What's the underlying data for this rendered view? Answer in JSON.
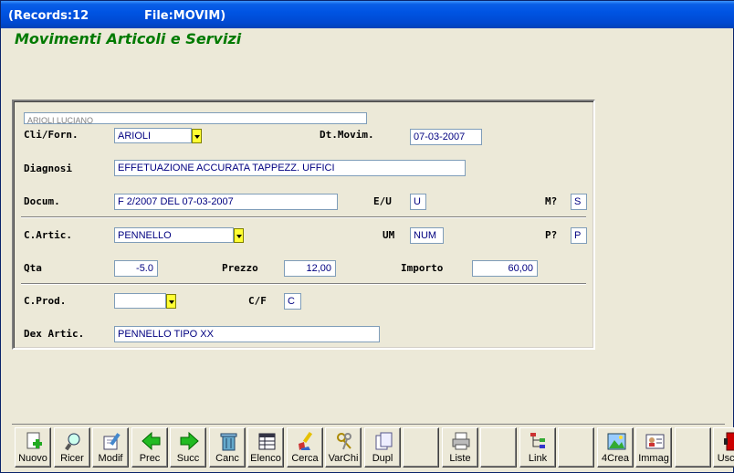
{
  "window": {
    "title_records": "(Records:12",
    "title_file": "File:MOVIM)"
  },
  "header": {
    "title": "Movimenti Articoli e Servizi"
  },
  "form": {
    "customer_name": "ARIOLI LUCIANO",
    "cli_forn": {
      "label": "Cli/Forn.",
      "value": "ARIOLI"
    },
    "dt_movim": {
      "label": "Dt.Movim.",
      "value": "07-03-2007"
    },
    "diagnosi": {
      "label": "Diagnosi",
      "value": "EFFETUAZIONE ACCURATA TAPPEZZ. UFFICI"
    },
    "docum": {
      "label": "Docum.",
      "value": "F 2/2007 DEL 07-03-2007"
    },
    "e_u": {
      "label": "E/U",
      "value": "U"
    },
    "m": {
      "label": "M?",
      "value": "S"
    },
    "c_artic": {
      "label": "C.Artic.",
      "value": "PENNELLO"
    },
    "um": {
      "label": "UM",
      "value": "NUM"
    },
    "p": {
      "label": "P?",
      "value": "P"
    },
    "qta": {
      "label": "Qta",
      "value": "-5.0"
    },
    "prezzo": {
      "label": "Prezzo",
      "value": "12,00"
    },
    "importo": {
      "label": "Importo",
      "value": "60,00"
    },
    "c_prod": {
      "label": "C.Prod.",
      "value": ""
    },
    "c_f": {
      "label": "C/F",
      "value": "C"
    },
    "dex_artic": {
      "label": "Dex Artic.",
      "value": "PENNELLO TIPO XX"
    }
  },
  "toolbar": {
    "buttons": [
      {
        "label": "Nuovo",
        "icon": "new-document-icon"
      },
      {
        "label": "Ricer",
        "icon": "search-icon"
      },
      {
        "label": "Modif",
        "icon": "edit-icon"
      },
      {
        "label": "Prec",
        "icon": "arrow-left-icon"
      },
      {
        "label": "Succ",
        "icon": "arrow-right-icon"
      },
      {
        "label": "Canc",
        "icon": "trash-icon"
      },
      {
        "label": "Elenco",
        "icon": "list-icon"
      },
      {
        "label": "Cerca",
        "icon": "brush-icon"
      },
      {
        "label": "VarChi",
        "icon": "keys-icon"
      },
      {
        "label": "Dupl",
        "icon": "copy-icon"
      },
      {
        "label": "",
        "icon": ""
      },
      {
        "label": "Liste",
        "icon": "printer-icon"
      },
      {
        "label": "",
        "icon": ""
      },
      {
        "label": "Link",
        "icon": "tree-icon"
      },
      {
        "label": "",
        "icon": ""
      },
      {
        "label": "4Crea",
        "icon": "image-icon"
      },
      {
        "label": "Immag",
        "icon": "id-card-icon"
      },
      {
        "label": "",
        "icon": ""
      },
      {
        "label": "Uscita",
        "icon": "exit-door-icon"
      }
    ]
  },
  "colors": {
    "title_green": "#007A00",
    "field_text": "#000080",
    "dropdown_yellow": "#FFFF33"
  }
}
